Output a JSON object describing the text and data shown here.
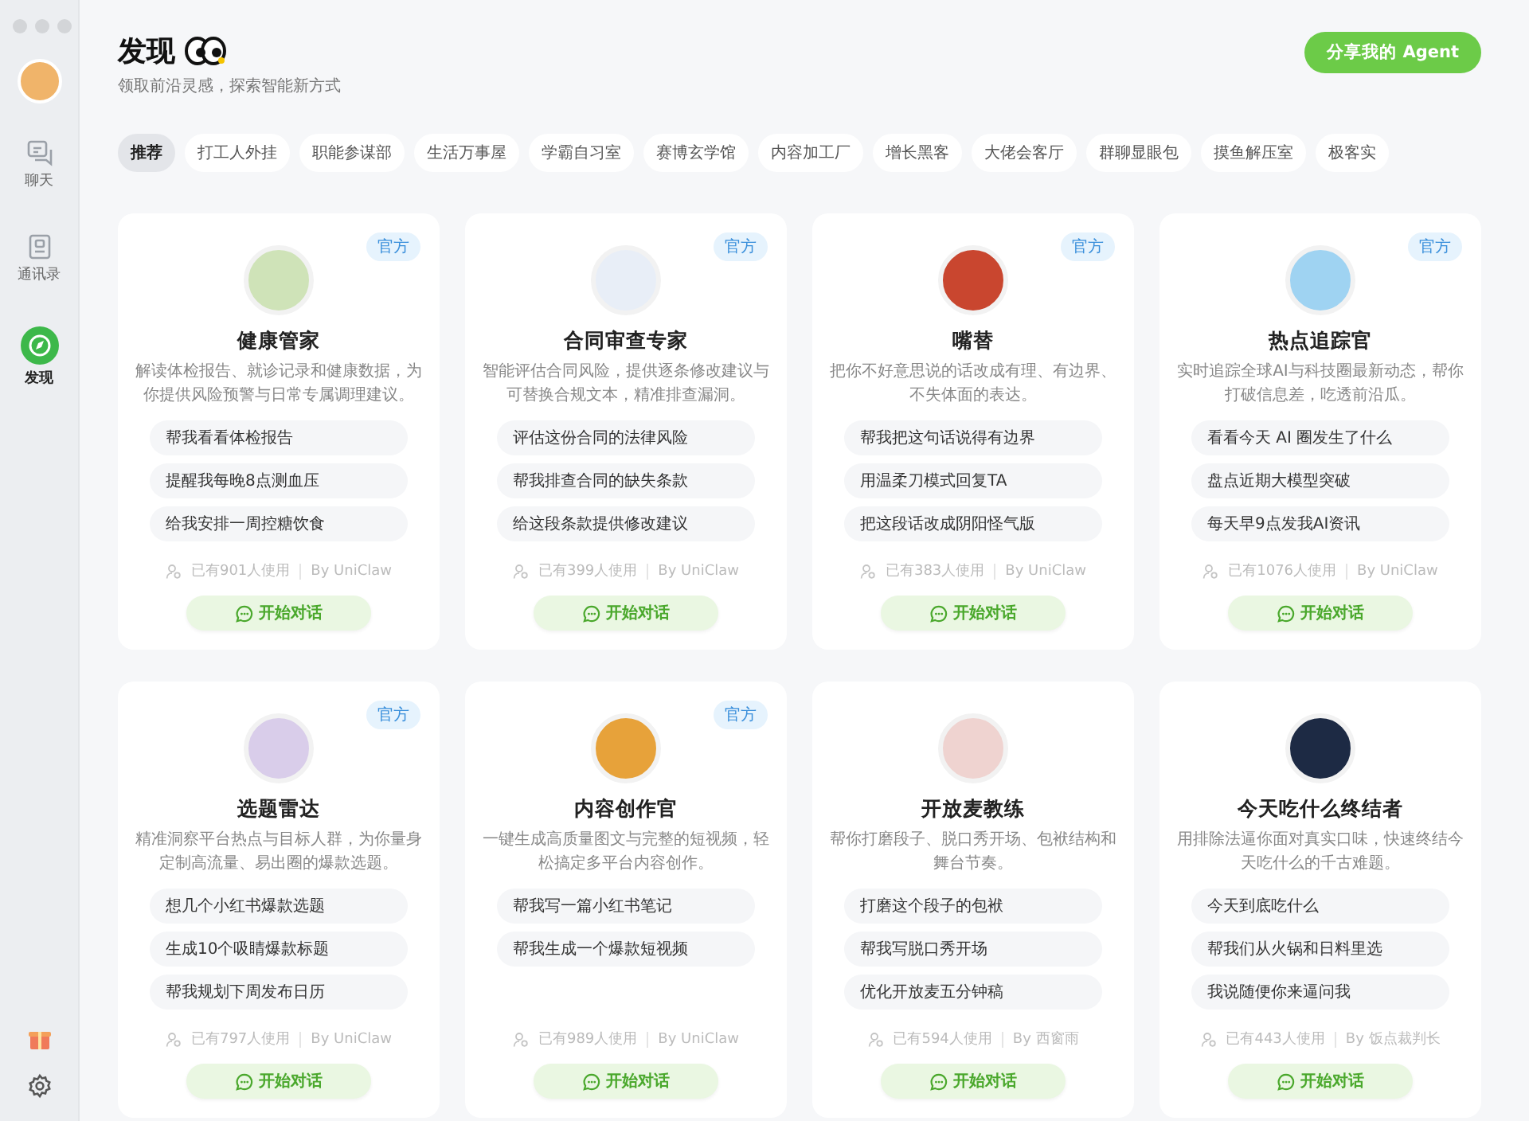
{
  "sidebar": {
    "items": [
      {
        "label": "聊天",
        "kind": "chat",
        "selected": false
      },
      {
        "label": "通讯录",
        "kind": "contacts",
        "selected": false
      },
      {
        "label": "发现",
        "kind": "discover",
        "selected": true
      }
    ]
  },
  "header": {
    "title": "发现",
    "subtitle": "领取前沿灵感，探索智能新方式",
    "share_button": "分享我的 Agent"
  },
  "tabs": [
    {
      "label": "推荐",
      "selected": true
    },
    {
      "label": "打工人外挂",
      "selected": false
    },
    {
      "label": "职能参谋部",
      "selected": false
    },
    {
      "label": "生活万事屋",
      "selected": false
    },
    {
      "label": "学霸自习室",
      "selected": false
    },
    {
      "label": "赛博玄学馆",
      "selected": false
    },
    {
      "label": "内容加工厂",
      "selected": false
    },
    {
      "label": "增长黑客",
      "selected": false
    },
    {
      "label": "大佬会客厅",
      "selected": false
    },
    {
      "label": "群聊显眼包",
      "selected": false
    },
    {
      "label": "摸鱼解压室",
      "selected": false
    },
    {
      "label": "极客实",
      "selected": false
    }
  ],
  "cards": [
    {
      "name": "健康管家",
      "official": true,
      "badge": "官方",
      "description": "解读体检报告、就诊记录和健康数据，为你提供风险预警与日常专属调理建议。",
      "prompts": [
        "帮我看看体检报告",
        "提醒我每晚8点测血压",
        "给我安排一周控糖饮食"
      ],
      "usage": "已有901人使用",
      "author": "By UniClaw",
      "button": "开始对话"
    },
    {
      "name": "合同审查专家",
      "official": true,
      "badge": "官方",
      "description": "智能评估合同风险，提供逐条修改建议与可替换合规文本，精准排查漏洞。",
      "prompts": [
        "评估这份合同的法律风险",
        "帮我排查合同的缺失条款",
        "给这段条款提供修改建议"
      ],
      "usage": "已有399人使用",
      "author": "By UniClaw",
      "button": "开始对话"
    },
    {
      "name": "嘴替",
      "official": true,
      "badge": "官方",
      "description": "把你不好意思说的话改成有理、有边界、不失体面的表达。",
      "prompts": [
        "帮我把这句话说得有边界",
        "用温柔刀模式回复TA",
        "把这段话改成阴阳怪气版"
      ],
      "usage": "已有383人使用",
      "author": "By UniClaw",
      "button": "开始对话"
    },
    {
      "name": "热点追踪官",
      "official": true,
      "badge": "官方",
      "description": "实时追踪全球AI与科技圈最新动态，帮你打破信息差，吃透前沿瓜。",
      "prompts": [
        "看看今天 AI 圈发生了什么",
        "盘点近期大模型突破",
        "每天早9点发我AI资讯"
      ],
      "usage": "已有1076人使用",
      "author": "By UniClaw",
      "button": "开始对话"
    },
    {
      "name": "选题雷达",
      "official": true,
      "badge": "官方",
      "description": "精准洞察平台热点与目标人群，为你量身定制高流量、易出圈的爆款选题。",
      "prompts": [
        "想几个小红书爆款选题",
        "生成10个吸睛爆款标题",
        "帮我规划下周发布日历"
      ],
      "usage": "已有797人使用",
      "author": "By UniClaw",
      "button": "开始对话"
    },
    {
      "name": "内容创作官",
      "official": true,
      "badge": "官方",
      "description": "一键生成高质量图文与完整的短视频，轻松搞定多平台内容创作。",
      "prompts": [
        "帮我写一篇小红书笔记",
        "帮我生成一个爆款短视频"
      ],
      "usage": "已有989人使用",
      "author": "By UniClaw",
      "button": "开始对话"
    },
    {
      "name": "开放麦教练",
      "official": false,
      "description": "帮你打磨段子、脱口秀开场、包袱结构和舞台节奏。",
      "prompts": [
        "打磨这个段子的包袱",
        "帮我写脱口秀开场",
        "优化开放麦五分钟稿"
      ],
      "usage": "已有594人使用",
      "author": "By 西窗雨",
      "button": "开始对话"
    },
    {
      "name": "今天吃什么终结者",
      "official": false,
      "description": "用排除法逼你面对真实口味，快速终结今天吃什么的千古难题。",
      "prompts": [
        "今天到底吃什么",
        "帮我们从火锅和日料里选",
        "我说随便你来逼问我"
      ],
      "usage": "已有443人使用",
      "author": "By 饭点裁判长",
      "button": "开始对话"
    }
  ]
}
